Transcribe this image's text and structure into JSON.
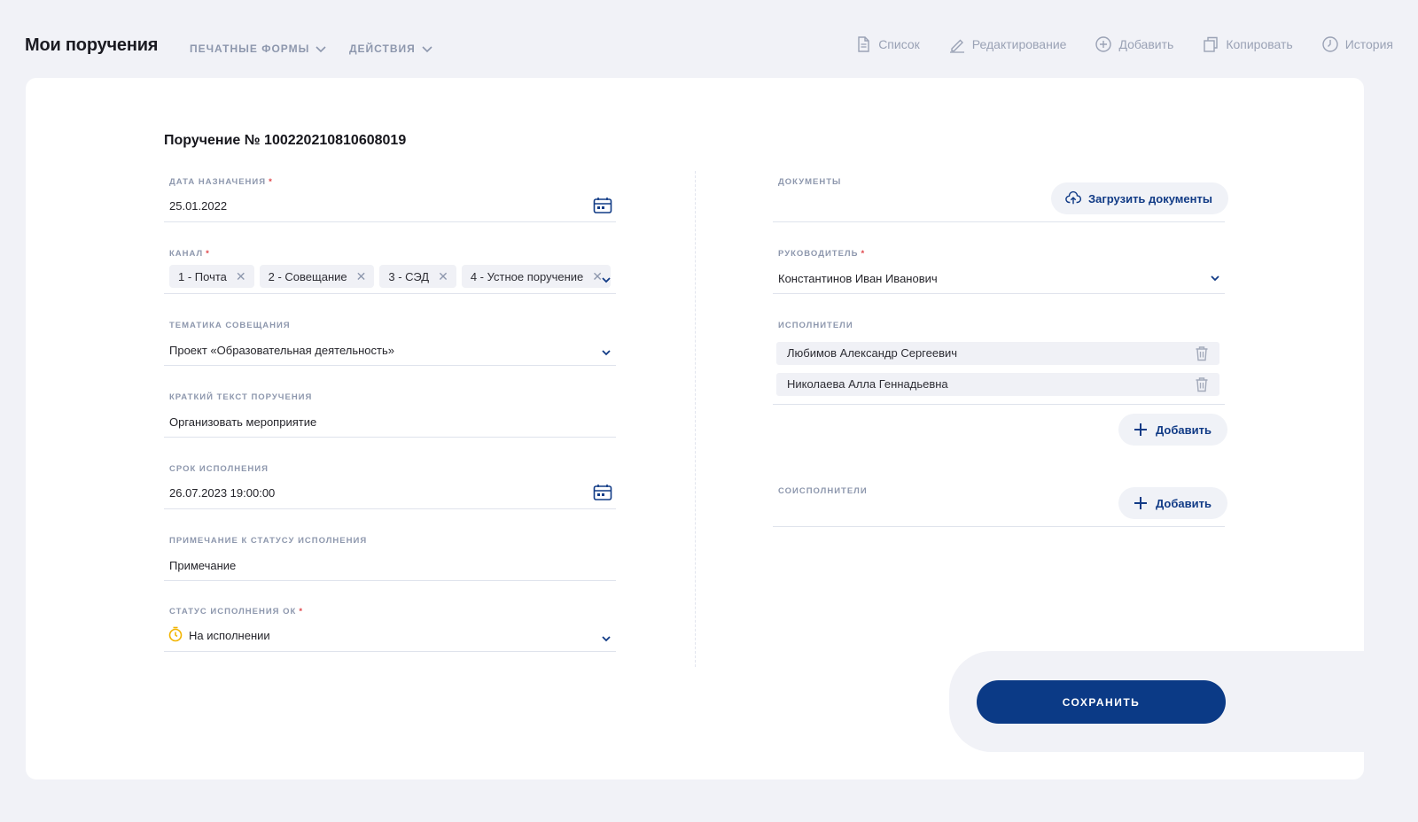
{
  "header": {
    "title": "Мои поручения",
    "menus": [
      "ПЕЧАТНЫЕ ФОРМЫ",
      "ДЕЙСТВИЯ"
    ],
    "toolbar": {
      "list": "Список",
      "edit": "Редактирование",
      "add": "Добавить",
      "copy": "Копировать",
      "history": "История"
    }
  },
  "form": {
    "title": "Поручение №  100220210810608019",
    "assign_date": {
      "label": "ДАТА НАЗНАЧЕНИЯ",
      "required": "*",
      "value": "25.01.2022"
    },
    "channel": {
      "label": "КАНАЛ",
      "required": "*",
      "chips": [
        "1 - Почта",
        "2 - Совещание",
        "3 - СЭД",
        "4 - Устное поручение"
      ]
    },
    "meeting_topic": {
      "label": "ТЕМАТИКА СОВЕЩАНИЯ",
      "value": "Проект «Образовательная деятельность»"
    },
    "short_text": {
      "label": "КРАТКИЙ ТЕКСТ ПОРУЧЕНИЯ",
      "value": "Организовать мероприятие"
    },
    "deadline": {
      "label": "СРОК ИСПОЛНЕНИЯ",
      "value": "26.07.2023 19:00:00"
    },
    "status_note": {
      "label": "ПРИМЕЧАНИЕ К СТАТУСУ ИСПОЛНЕНИЯ",
      "value": "Примечание"
    },
    "status": {
      "label": "СТАТУС ИСПОЛНЕНИЯ ОК",
      "required": "*",
      "value": "На исполнении"
    },
    "documents": {
      "label": "ДОКУМЕНТЫ",
      "upload_label": "Загрузить документы"
    },
    "manager": {
      "label": "РУКОВОДИТЕЛЬ",
      "required": "*",
      "value": "Константинов Иван Иванович"
    },
    "executors": {
      "label": "ИСПОЛНИТЕЛИ",
      "people": [
        "Любимов Александр Сергеевич",
        "Николаева Алла Геннадьевна"
      ],
      "add_label": "Добавить"
    },
    "coexecutors": {
      "label": "СОИСПОЛНИТЕЛИ",
      "add_label": "Добавить"
    },
    "save_label": "СОХРАНИТЬ"
  },
  "colors": {
    "accent": "#0b3a86",
    "link": "#113b86",
    "label": "#8d97ad",
    "required": "#e0474c",
    "status_icon": "#f2b400",
    "page_bg": "#f1f2f7"
  }
}
